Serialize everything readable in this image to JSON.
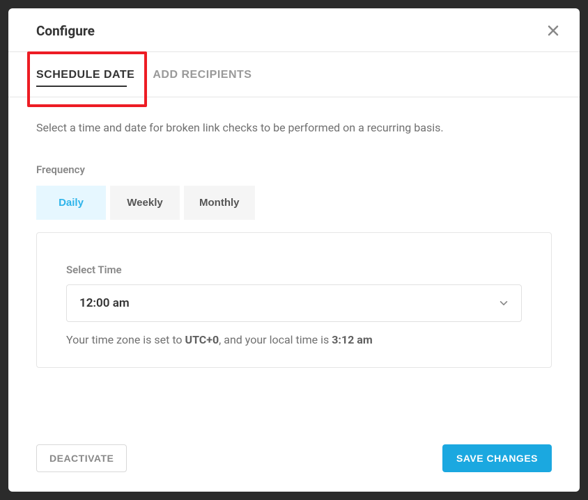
{
  "header": {
    "title": "Configure"
  },
  "tabs": {
    "schedule_date": "SCHEDULE DATE",
    "add_recipients": "ADD RECIPIENTS"
  },
  "body": {
    "description": "Select a time and date for broken link checks to be performed on a recurring basis.",
    "frequency_label": "Frequency",
    "frequency_options": {
      "daily": "Daily",
      "weekly": "Weekly",
      "monthly": "Monthly"
    },
    "select_time_label": "Select Time",
    "selected_time": "12:00 am",
    "timezone_prefix": "Your time zone is set to ",
    "timezone_value": "UTC+0",
    "timezone_middle": ", and your local time is ",
    "local_time": "3:12 am"
  },
  "footer": {
    "deactivate": "DEACTIVATE",
    "save": "SAVE CHANGES"
  }
}
